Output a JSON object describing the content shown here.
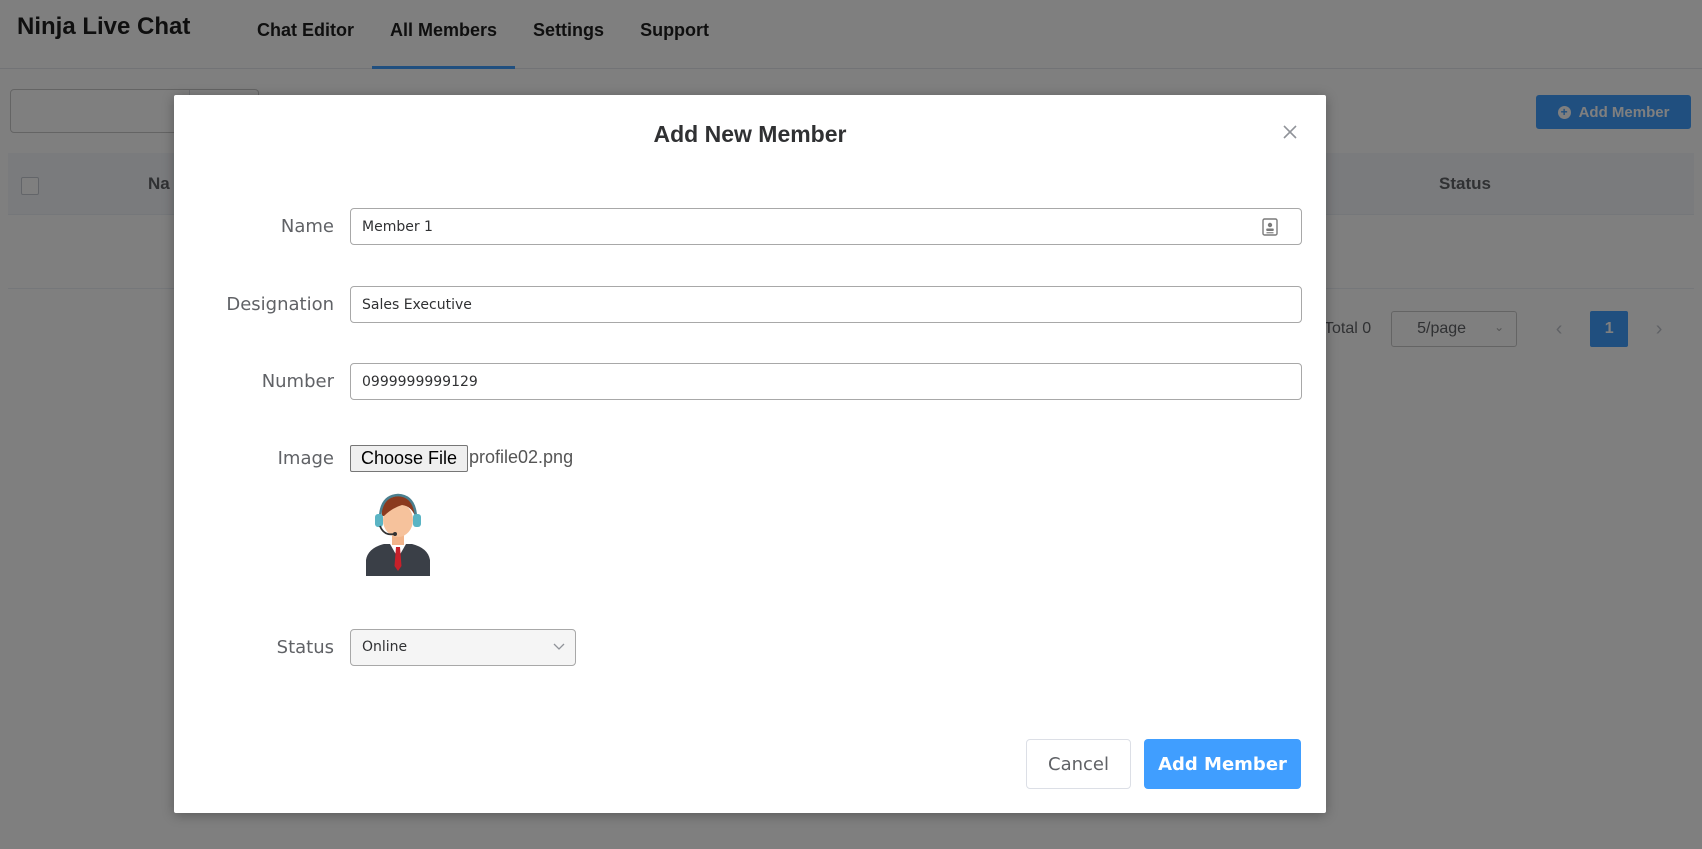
{
  "app": {
    "title": "Ninja Live Chat",
    "nav": [
      "Chat Editor",
      "All Members",
      "Settings",
      "Support"
    ],
    "active_nav": "All Members"
  },
  "page": {
    "add_button_label": "Add Member",
    "table_headers": {
      "name": "Na",
      "status": "Status"
    },
    "pagination": {
      "total": "Total 0",
      "page_size": "5/page",
      "current_page": "1"
    }
  },
  "modal": {
    "title": "Add New Member",
    "fields": {
      "name": {
        "label": "Name",
        "value": "Member 1"
      },
      "designation": {
        "label": "Designation",
        "value": "Sales Executive"
      },
      "number": {
        "label": "Number",
        "value": "0999999999129"
      },
      "image": {
        "label": "Image",
        "button": "Choose File",
        "file_name": "profile02.png"
      },
      "status": {
        "label": "Status",
        "value": "Online"
      }
    },
    "cancel_label": "Cancel",
    "submit_label": "Add Member"
  },
  "colors": {
    "accent": "#409eff",
    "overlay": "rgba(0,0,0,0.5)"
  },
  "icons": {
    "close": "close-icon",
    "contact": "contact-card-icon",
    "chevron": "chevron-down-icon",
    "add": "plus-circle-icon"
  }
}
